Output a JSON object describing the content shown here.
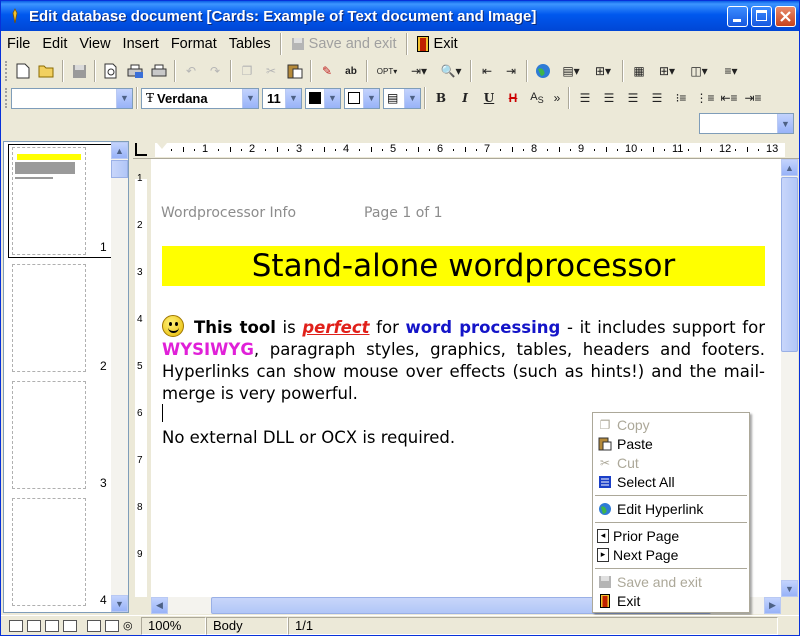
{
  "window": {
    "title": "Edit database document [Cards: Example of Text document and Image]"
  },
  "menu": {
    "file": "File",
    "edit": "Edit",
    "view": "View",
    "insert": "Insert",
    "format": "Format",
    "tables": "Tables",
    "save_exit": "Save and exit",
    "exit": "Exit"
  },
  "format_bar": {
    "style_value": "",
    "font_value": "Verdana",
    "size_value": "11"
  },
  "thumbnails": {
    "page_numbers": [
      "1",
      "2",
      "3",
      "4"
    ]
  },
  "ruler": {
    "marks": [
      "1",
      "2",
      "3",
      "4",
      "5",
      "6",
      "7",
      "8",
      "9",
      "10",
      "11",
      "12",
      "13"
    ],
    "vmarks": [
      "1",
      "2",
      "3",
      "4",
      "5",
      "6",
      "7",
      "8",
      "9"
    ]
  },
  "document": {
    "header_left": "Wordprocessor Info",
    "header_right": "Page 1 of 1",
    "banner": "Stand-alone wordprocessor",
    "p1_this_tool": "This tool",
    "p1_is": " is ",
    "p1_perfect": "perfect",
    "p1_for": " for ",
    "p1_word_processing": "word processing",
    "p1_rest1": " - it includes support for ",
    "p1_wysiwyg": "WYSIWYG",
    "p1_rest2": ", paragraph styles, graphics, tables, headers and footers. Hyperlinks can show mouse over effects (such as hints!) and the mail-merge is very powerful.",
    "p2": "No external DLL or OCX is required."
  },
  "context_menu": {
    "copy": "Copy",
    "paste": "Paste",
    "cut": "Cut",
    "select_all": "Select All",
    "edit_hyperlink": "Edit Hyperlink",
    "prior_page": "Prior Page",
    "next_page": "Next Page",
    "save_exit": "Save and exit",
    "exit": "Exit"
  },
  "status": {
    "zoom": "100%",
    "style": "Body",
    "page": "1/1"
  },
  "colors": {
    "banner_bg": "#FFFF00",
    "perfect": "#E0201A",
    "word_processing": "#1414C8",
    "wysiwyg": "#E020D8",
    "titlebar": "#0058EE"
  }
}
